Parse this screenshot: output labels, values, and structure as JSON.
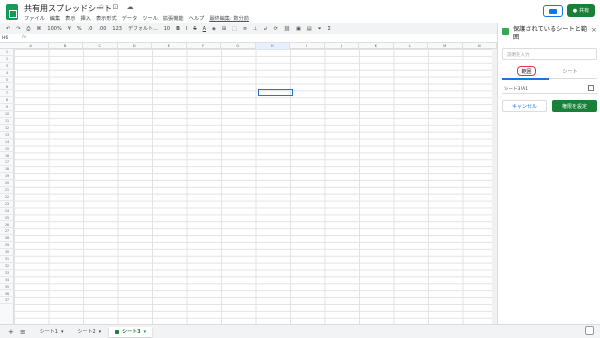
{
  "header": {
    "title": "共有用スプレッドシート",
    "title_icons": "☆ ⊡ ☁",
    "menu": [
      "ファイル",
      "編集",
      "表示",
      "挿入",
      "表示形式",
      "データ",
      "ツール",
      "拡張機能",
      "ヘルプ"
    ],
    "last_edit": "最終編集: 数分前",
    "share_label": "共有"
  },
  "toolbar": {
    "undo": "↶",
    "redo": "↷",
    "print": "⎙",
    "paint": "⌘",
    "zoom": "100%",
    "currency": "¥",
    "percent": "%",
    "dec_less": ".0",
    "dec_more": ".00",
    "number_format": "123",
    "font": "デフォルト...",
    "font_size": "10",
    "bold": "B",
    "italic": "I",
    "strike": "S",
    "text_color": "A"
  },
  "formula_bar": {
    "cell_ref": "H6",
    "fx": "fx"
  },
  "grid": {
    "columns": [
      "A",
      "B",
      "C",
      "D",
      "E",
      "F",
      "G",
      "H",
      "I",
      "J",
      "K",
      "L",
      "M",
      "N"
    ],
    "selected_column": "H",
    "row_count": 37
  },
  "sheet_tabs": {
    "tabs": [
      {
        "label": "シート1",
        "active": false
      },
      {
        "label": "シート2",
        "active": false
      },
      {
        "label": "シート3",
        "active": true
      }
    ]
  },
  "side_panel": {
    "title": "保護されているシートと範囲",
    "description_placeholder": "説明を入力",
    "tab_range": "範囲",
    "tab_sheet": "シート",
    "range_value": "シート3!A1",
    "cancel_label": "キャンセル",
    "set_label": "権限を設定"
  }
}
